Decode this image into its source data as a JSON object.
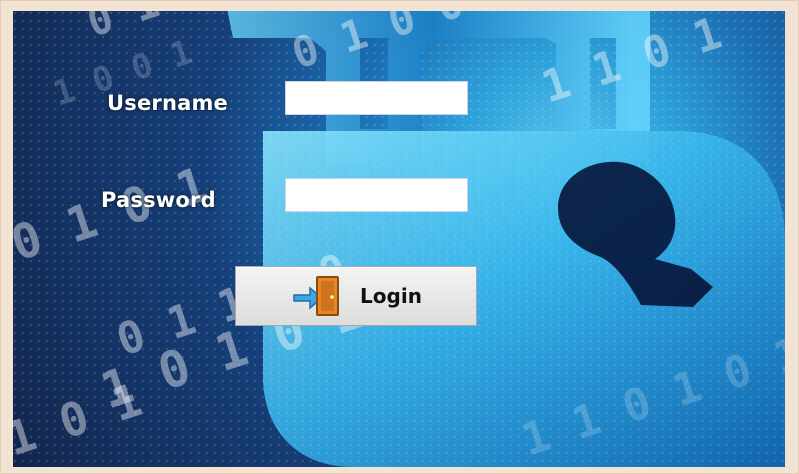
{
  "login_form": {
    "username_label": "Username",
    "password_label": "Password",
    "username_value": "",
    "password_value": "",
    "login_button_label": "Login",
    "login_button_icon": "door-enter-icon"
  },
  "background": {
    "digits": [
      "0 1 1 0",
      "1 0 0 1",
      "0 1 0 0 0 1",
      "1 1 0 1",
      "0 1 0 1",
      "1 0 1 0 1",
      "1 0 1",
      "0 1 1 0 0",
      "1 1 0 1 0 1"
    ]
  },
  "colors": {
    "window_frame": "#f3e3d3",
    "panel_dark": "#12264d",
    "panel_light": "#58c8ef",
    "label_text": "#ffffff",
    "button_text": "#111111"
  }
}
